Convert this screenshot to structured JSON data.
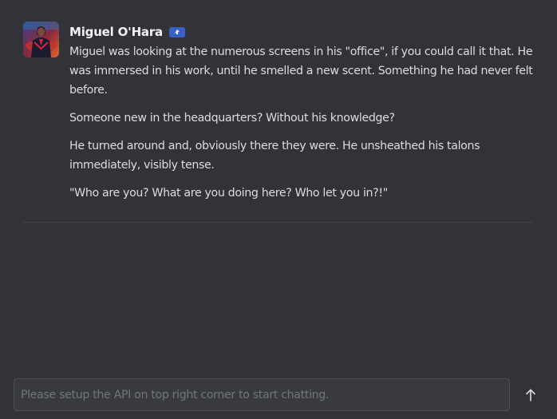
{
  "message": {
    "author": "Miguel O'Hara",
    "paragraphs": [
      "Miguel was looking at the numerous screens in his \"office\", if you could call it that. He was immersed in his work, until he smelled a new scent. Something he had never felt before.",
      "Someone new in the headquarters? Without his knowledge?",
      "He turned around and, obviously there they were. He unsheathed his talons immediately, visibly tense.",
      "\"Who are you? What are you doing here? Who let you in?!\""
    ]
  },
  "composer": {
    "placeholder": "Please setup the API on top right corner to start chatting.",
    "value": ""
  },
  "icons": {
    "bot_badge": "bot-badge-icon",
    "send": "arrow-up-icon"
  },
  "colors": {
    "background": "#323338",
    "text": "#dcdde0",
    "badge": "#3c5fc4",
    "divider": "#404249",
    "input_border": "#4e5058"
  }
}
